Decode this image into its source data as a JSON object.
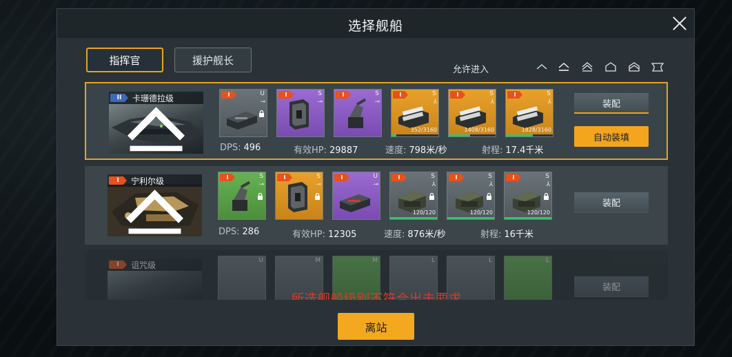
{
  "dialog": {
    "title": "选择舰船",
    "tabs": {
      "commander": "指挥官",
      "escort": "援护舰长"
    },
    "allow_entry_label": "允许进入",
    "class_filter_icons": [
      "frigate-class-icon",
      "destroyer-class-icon",
      "cruiser-class-icon",
      "battlecruiser-class-icon",
      "battleship-class-icon",
      "carrier-class-icon"
    ],
    "warning": "所选舰船级别不符合出击要求",
    "depart_label": "离站"
  },
  "ships": [
    {
      "grade": "II",
      "name": "卡珊德拉级",
      "selected": true,
      "modules": [
        {
          "grade": "I",
          "type": "U",
          "color": "gray",
          "icon": "missile-launcher-icon",
          "locked": true
        },
        {
          "grade": "I",
          "type": "S",
          "color": "purple",
          "icon": "shield-module-icon",
          "locked": false
        },
        {
          "grade": "I",
          "type": "S",
          "color": "purple",
          "icon": "turret-module-icon",
          "locked": false
        },
        {
          "grade": "I",
          "type": "S",
          "color": "orange",
          "icon": "fighter-bay-icon",
          "hp": "352/3160",
          "hp_fraction": 0.11
        },
        {
          "grade": "I",
          "type": "S",
          "color": "orange",
          "icon": "fighter-bay-icon",
          "hp": "1408/3160",
          "hp_fraction": 0.45
        },
        {
          "grade": "I",
          "type": "S",
          "color": "orange",
          "icon": "fighter-bay-icon",
          "hp": "1828/3160",
          "hp_fraction": 0.58
        }
      ],
      "stats": {
        "dps_label": "DPS:",
        "dps": "496",
        "hp_label": "有效HP:",
        "hp": "29887",
        "speed_label": "速度:",
        "speed": "798米/秒",
        "range_label": "射程:",
        "range": "17.4千米"
      },
      "buttons": {
        "equip": "装配",
        "auto": "自动装填"
      }
    },
    {
      "grade": "I",
      "name": "宁利尔级",
      "selected": false,
      "modules": [
        {
          "grade": "I",
          "type": "S",
          "color": "green",
          "icon": "turret-module-icon",
          "locked": true
        },
        {
          "grade": "I",
          "type": "S",
          "color": "orange",
          "icon": "shield-module-icon",
          "locked": true
        },
        {
          "grade": "I",
          "type": "U",
          "color": "purple",
          "icon": "missile-launcher-icon",
          "locked": false
        },
        {
          "grade": "I",
          "type": "S",
          "color": "gray",
          "icon": "fighter-bay-icon",
          "hp": "120/120",
          "hp_fraction": 1.0,
          "locked": true
        },
        {
          "grade": "I",
          "type": "S",
          "color": "gray",
          "icon": "fighter-bay-icon",
          "hp": "120/120",
          "hp_fraction": 1.0,
          "locked": true
        },
        {
          "grade": "I",
          "type": "S",
          "color": "gray",
          "icon": "fighter-bay-icon",
          "hp": "120/120",
          "hp_fraction": 1.0,
          "locked": true
        }
      ],
      "stats": {
        "dps_label": "DPS:",
        "dps": "286",
        "hp_label": "有效HP:",
        "hp": "12305",
        "speed_label": "速度:",
        "speed": "876米/秒",
        "range_label": "射程:",
        "range": "16千米"
      },
      "buttons": {
        "equip": "装配"
      }
    },
    {
      "grade": "I",
      "name": "诅咒级",
      "selected": false,
      "disabled": true,
      "modules": [
        {
          "type": "U",
          "color": "gray"
        },
        {
          "type": "M",
          "color": "gray"
        },
        {
          "type": "M",
          "color": "green"
        },
        {
          "type": "L",
          "color": "gray"
        },
        {
          "type": "L",
          "color": "gray"
        },
        {
          "type": "L",
          "color": "green"
        }
      ],
      "buttons": {
        "equip": "装配"
      }
    }
  ],
  "colors": {
    "accent": "#e9a51d",
    "warning": "#d33b2c",
    "hp_bar": "#38c16b",
    "grade_badge": "#e5521c"
  }
}
